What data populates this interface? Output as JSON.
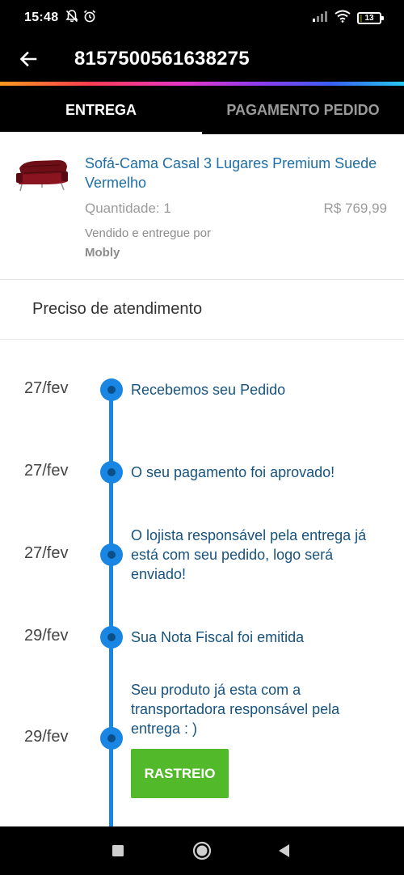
{
  "status_bar": {
    "time": "15:48",
    "battery": "13",
    "icons": [
      "notifications-off-icon",
      "alarm-icon",
      "signal-icon",
      "wifi-icon",
      "battery-icon"
    ]
  },
  "app_bar": {
    "order_number": "8157500561638275",
    "back_icon": "arrow-left-icon"
  },
  "tabs": [
    {
      "label": "ENTREGA",
      "active": true
    },
    {
      "label": "PAGAMENTO PEDIDO",
      "active": false
    }
  ],
  "product": {
    "name": "Sofá-Cama Casal 3 Lugares Premium Suede Vermelho",
    "quantity": "Quantidade: 1",
    "price": "R$ 769,99",
    "sold_by": "Vendido e entregue por",
    "seller": "Mobly"
  },
  "support": {
    "label": "Preciso de atendimento"
  },
  "timeline": [
    {
      "date": "27/fev",
      "text": "Recebemos seu Pedido"
    },
    {
      "date": "27/fev",
      "text": "O seu pagamento foi aprovado!"
    },
    {
      "date": "27/fev",
      "text": "O lojista responsável pela entrega já está com seu pedido, logo será enviado!"
    },
    {
      "date": "29/fev",
      "text": "Sua Nota Fiscal foi emitida"
    },
    {
      "date": "29/fev",
      "text": "Seu produto já esta com a transportadora responsável pela entrega : )"
    }
  ],
  "track_button": {
    "label": "RASTREIO"
  },
  "colors": {
    "timeline_blue": "#1a86e3",
    "link_blue": "#1e6fa6",
    "button_green": "#52b92b"
  },
  "nav_bar": {
    "icons": [
      "recents-square-icon",
      "home-circle-icon",
      "back-triangle-icon"
    ]
  }
}
